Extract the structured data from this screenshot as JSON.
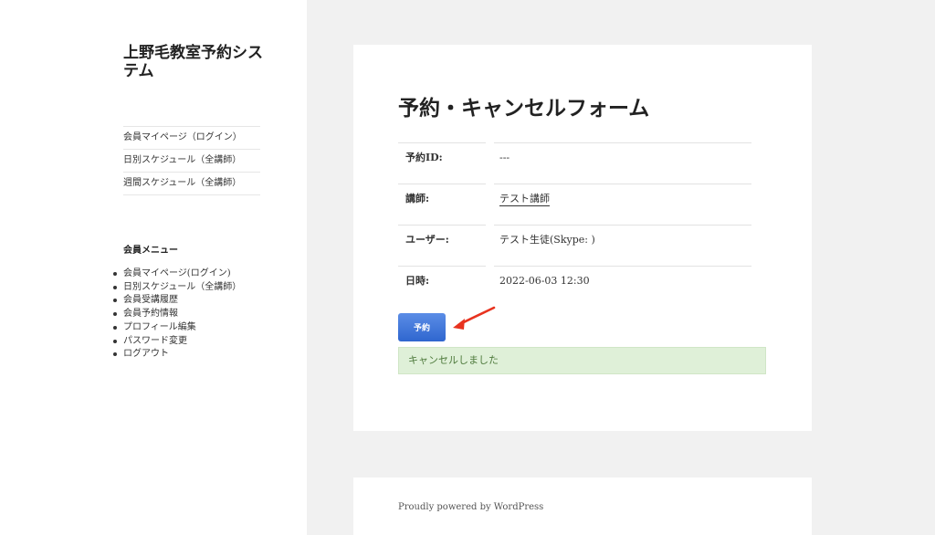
{
  "site": {
    "title": "上野毛教室予約システム"
  },
  "nav": {
    "items": [
      {
        "label": "会員マイページ（ログイン）"
      },
      {
        "label": "日別スケジュール（全講師）"
      },
      {
        "label": "週間スケジュール（全講師）"
      }
    ]
  },
  "member_menu": {
    "title": "会員メニュー",
    "items": [
      {
        "label": "会員マイページ(ログイン)"
      },
      {
        "label": "日別スケジュール（全講師）"
      },
      {
        "label": "会員受講履歴"
      },
      {
        "label": "会員予約情報"
      },
      {
        "label": "プロフィール編集"
      },
      {
        "label": "パスワード変更"
      },
      {
        "label": "ログアウト"
      }
    ]
  },
  "form": {
    "title": "予約・キャンセルフォーム",
    "rows": [
      {
        "label": "予約ID:",
        "value": "---"
      },
      {
        "label": "講師:",
        "value": "テスト講師"
      },
      {
        "label": "ユーザー:",
        "value": "テスト生徒(Skype: )"
      },
      {
        "label": "日時:",
        "value": "2022-06-03 12:30"
      }
    ],
    "submit_label": "予約",
    "notice": "キャンセルしました"
  },
  "footer": {
    "text": "Proudly powered by WordPress"
  },
  "colors": {
    "button": "#3a73d9",
    "notice_bg": "#dff0d8",
    "annotation_arrow": "#e8331f"
  }
}
